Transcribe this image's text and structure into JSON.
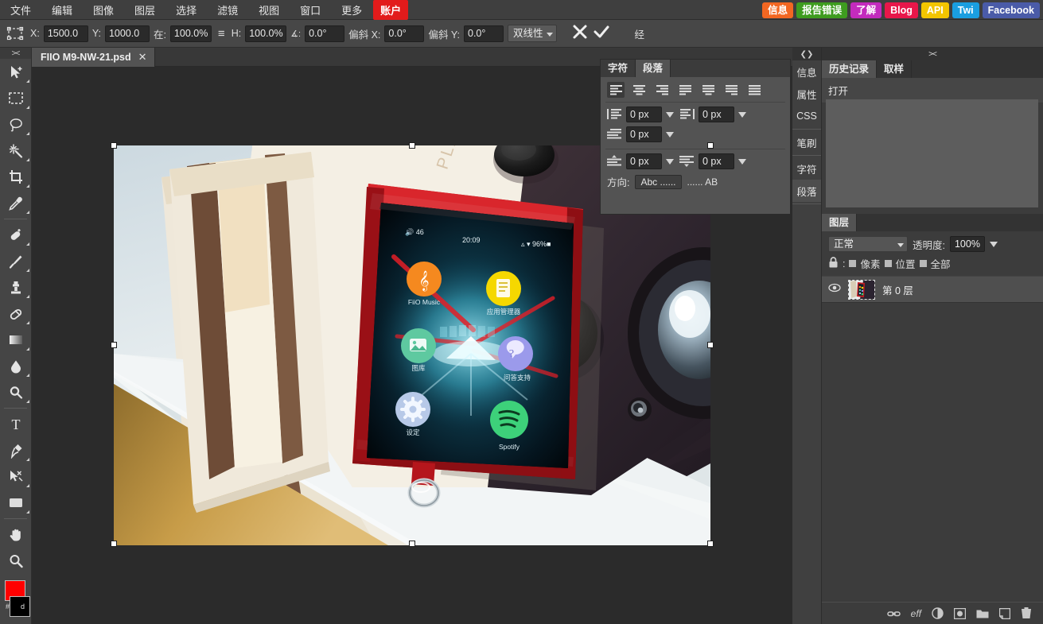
{
  "menubar": {
    "items": [
      {
        "label": "文件",
        "accent": false
      },
      {
        "label": "编辑",
        "accent": false
      },
      {
        "label": "图像",
        "accent": false
      },
      {
        "label": "图层",
        "accent": false
      },
      {
        "label": "选择",
        "accent": false
      },
      {
        "label": "滤镜",
        "accent": false
      },
      {
        "label": "视图",
        "accent": false
      },
      {
        "label": "窗口",
        "accent": false
      },
      {
        "label": "更多",
        "accent": false
      },
      {
        "label": "账户",
        "accent": true
      }
    ],
    "right_links": [
      {
        "label": "信息",
        "bg": "#f26722",
        "fg": "#ffffff"
      },
      {
        "label": "报告错误",
        "bg": "#3e9c1f",
        "fg": "#ffffff"
      },
      {
        "label": "了解",
        "bg": "#c32bbd",
        "fg": "#ffffff"
      },
      {
        "label": "Blog",
        "bg": "#e8174a",
        "fg": "#ffffff"
      },
      {
        "label": "API",
        "bg": "#f2c500",
        "fg": "#ffffff"
      },
      {
        "label": "Twi",
        "bg": "#1a9ee0",
        "fg": "#ffffff"
      },
      {
        "label": "Facebook",
        "bg": "#4a5ba8",
        "fg": "#ffffff"
      }
    ],
    "accent_color": "#e21b1b"
  },
  "optionsbar": {
    "x_label": "X:",
    "x_value": "1500.0",
    "y_label": "Y:",
    "y_value": "1000.0",
    "w_label": "在:",
    "w_value": "100.0%",
    "link_icon": "link-chain-icon",
    "h_label": "H:",
    "h_value": "100.0%",
    "angle_label": "∡:",
    "angle_value": "0.0°",
    "skew_x_label": "偏斜 X:",
    "skew_x_value": "0.0°",
    "skew_y_label": "偏斜 Y:",
    "skew_y_value": "0.0°",
    "interp_value": "双线性",
    "cancel_icon": "cancel-x-icon",
    "commit_icon": "commit-check-icon",
    "trailing_label": "经"
  },
  "toolbar": {
    "grip": "><",
    "tools": [
      {
        "name": "move-tool",
        "sep_after": false
      },
      {
        "name": "rectangular-marquee-tool",
        "sep_after": false
      },
      {
        "name": "lasso-tool",
        "sep_after": false
      },
      {
        "name": "magic-wand-tool",
        "sep_after": false
      },
      {
        "name": "crop-tool",
        "sep_after": false
      },
      {
        "name": "eyedropper-tool",
        "sep_after": true
      },
      {
        "name": "healing-brush-tool",
        "sep_after": false
      },
      {
        "name": "brush-tool",
        "sep_after": false
      },
      {
        "name": "clone-stamp-tool",
        "sep_after": false
      },
      {
        "name": "eraser-tool",
        "sep_after": false
      },
      {
        "name": "gradient-tool",
        "sep_after": false
      },
      {
        "name": "blur-tool",
        "sep_after": false
      },
      {
        "name": "dodge-tool",
        "sep_after": true
      },
      {
        "name": "type-tool",
        "sep_after": false
      },
      {
        "name": "pen-tool",
        "sep_after": false
      },
      {
        "name": "path-selection-tool",
        "sep_after": false
      },
      {
        "name": "shape-tool",
        "sep_after": true
      },
      {
        "name": "hand-tool",
        "sep_after": false
      },
      {
        "name": "zoom-tool",
        "sep_after": false
      }
    ],
    "foreground_color": "#ff0000",
    "background_color": "#000000",
    "swatch_mini_a": "#",
    "swatch_mini_b": "d"
  },
  "document": {
    "tab_title": "FIIO M9-NW-21.psd",
    "close_icon": "close-icon"
  },
  "paragraph_panel": {
    "tabs": [
      {
        "label": "字符",
        "active": false
      },
      {
        "label": "段落",
        "active": true
      }
    ],
    "align_buttons": [
      {
        "name": "align-left",
        "active": true
      },
      {
        "name": "align-center",
        "active": false
      },
      {
        "name": "align-right",
        "active": false
      },
      {
        "name": "justify-last-left",
        "active": false
      },
      {
        "name": "justify-last-center",
        "active": false
      },
      {
        "name": "justify-last-right",
        "active": false
      },
      {
        "name": "justify-all",
        "active": false
      }
    ],
    "indent_left_value": "0 px",
    "indent_right_value": "0 px",
    "indent_first_value": "0 px",
    "space_before_value": "0 px",
    "space_after_value": "0 px",
    "direction_label": "方向:",
    "direction_ltr": "Abc ......",
    "direction_rtl": "...... AB"
  },
  "dock": {
    "grip": "><",
    "vtabs": [
      {
        "label": "信息",
        "active": false,
        "sep_after": false
      },
      {
        "label": "属性",
        "active": false,
        "sep_after": false
      },
      {
        "label": "CSS",
        "active": false,
        "sep_after": true
      },
      {
        "label": "笔刷",
        "active": false,
        "sep_after": true
      },
      {
        "label": "字符",
        "active": false,
        "sep_after": false
      },
      {
        "label": "段落",
        "active": true,
        "sep_after": true
      }
    ],
    "history": {
      "tabs": [
        {
          "label": "历史记录",
          "active": true
        },
        {
          "label": "取样",
          "active": false
        }
      ],
      "entries": [
        "打开"
      ]
    },
    "layers": {
      "tabs": [
        {
          "label": "图层",
          "active": true
        }
      ],
      "blend_mode": "正常",
      "opacity_label": "透明度:",
      "opacity_value": "100%",
      "lock_icon": "lock-icon",
      "lock_label": ":",
      "lock_options": [
        {
          "label": "像素"
        },
        {
          "label": "位置"
        },
        {
          "label": "全部"
        }
      ],
      "rows": [
        {
          "visibility_icon": "eye-icon",
          "thumb": "layer-thumbnail",
          "name": "第 0 层"
        }
      ],
      "bottom_icons": [
        {
          "name": "link-layers-icon",
          "glyph": "⊂⊃"
        },
        {
          "name": "layer-effects-icon",
          "glyph": "eff"
        },
        {
          "name": "adjustment-layer-icon",
          "glyph": "half-circle"
        },
        {
          "name": "layer-mask-icon",
          "glyph": "mask"
        },
        {
          "name": "new-group-icon",
          "glyph": "folder"
        },
        {
          "name": "new-layer-icon",
          "glyph": "page"
        },
        {
          "name": "delete-layer-icon",
          "glyph": "trash"
        }
      ]
    }
  },
  "canvas": {
    "image_alt": "FiiO M9 red leather case portable music player on wooden speaker",
    "selection_handles": 8,
    "device_screen": {
      "status_volume": "46",
      "status_time": "20:09",
      "status_battery": "96%",
      "apps": [
        {
          "label": "FiiO Music",
          "color": "#f5891f"
        },
        {
          "label": "应用管理器",
          "color": "#f5d800"
        },
        {
          "label": "图库",
          "color": "#5ec9a0"
        },
        {
          "label": "问答支持",
          "color": "#9b9aeb"
        },
        {
          "label": "设定",
          "color": "#b7c9e8"
        },
        {
          "label": "Spotify",
          "color": "#3dd17a"
        }
      ]
    }
  }
}
